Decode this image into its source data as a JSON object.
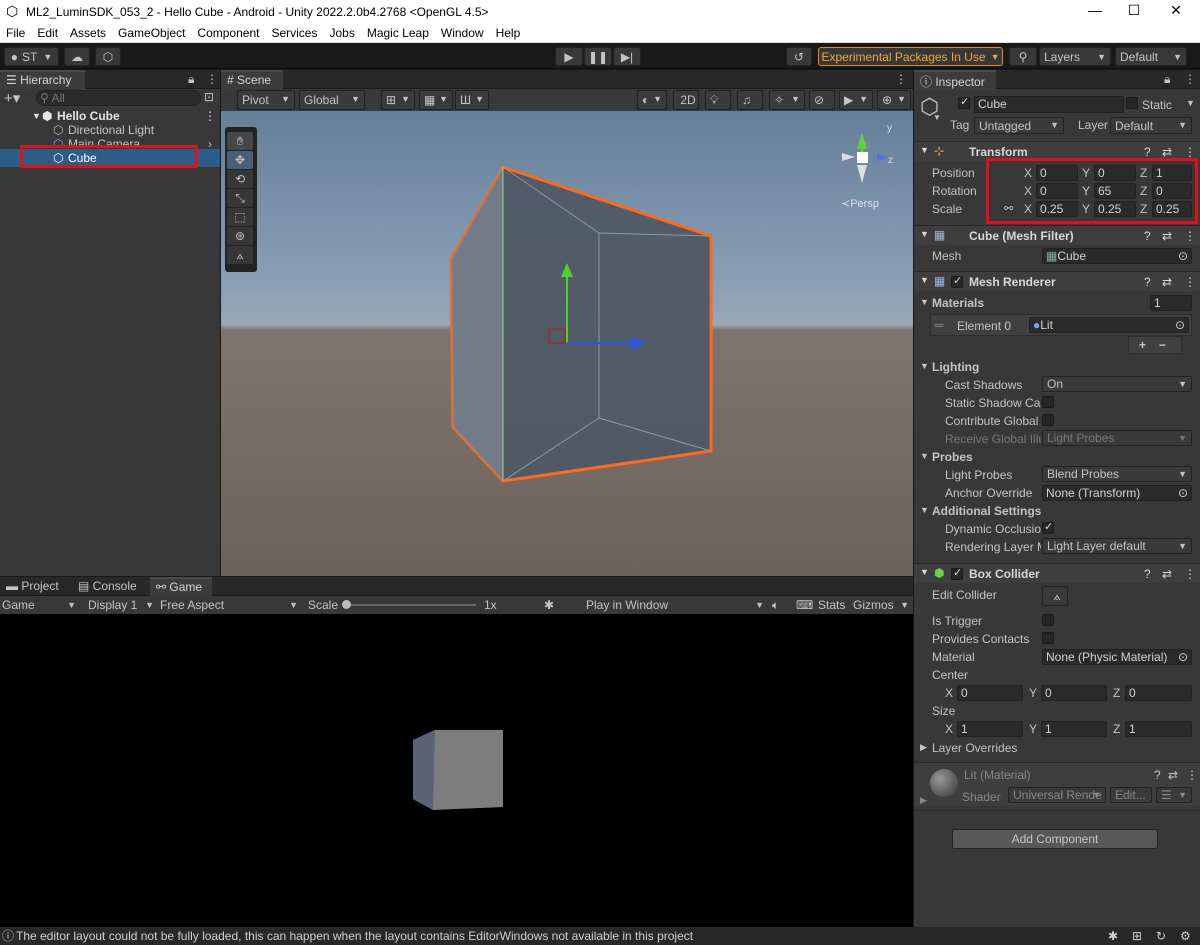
{
  "window": {
    "title": "ML2_LuminSDK_053_2 - Hello Cube - Android - Unity 2022.2.0b4.2768 <OpenGL 4.5>",
    "minimize": "—",
    "maximize": "☐",
    "close": "✕"
  },
  "menu": [
    "File",
    "Edit",
    "Assets",
    "GameObject",
    "Component",
    "Services",
    "Jobs",
    "Magic Leap",
    "Window",
    "Help"
  ],
  "toolbar": {
    "account": "ST",
    "experimental": "Experimental Packages In Use",
    "layers": "Layers",
    "layout": "Default"
  },
  "hierarchy": {
    "tab": "Hierarchy",
    "search_placeholder": "All",
    "scene": "Hello Cube",
    "items": [
      "Directional Light",
      "Main Camera",
      "Cube"
    ]
  },
  "scene_view": {
    "tab": "Scene",
    "pivot": "Pivot",
    "global": "Global",
    "mode2d": "2D",
    "persp": "Persp"
  },
  "bottom": {
    "tabs": [
      "Project",
      "Console",
      "Game"
    ],
    "game": "Game",
    "display": "Display 1",
    "aspect": "Free Aspect",
    "scale_label": "Scale",
    "scale_value": "1x",
    "play_in": "Play in Window",
    "stats": "Stats",
    "gizmos": "Gizmos"
  },
  "inspector": {
    "tab": "Inspector",
    "name": "Cube",
    "static": "Static",
    "tag_label": "Tag",
    "tag": "Untagged",
    "layer_label": "Layer",
    "layer": "Default",
    "transform": {
      "title": "Transform",
      "position_label": "Position",
      "rotation_label": "Rotation",
      "scale_label": "Scale",
      "position": [
        "0",
        "0",
        "1"
      ],
      "rotation": [
        "0",
        "65",
        "0"
      ],
      "scale": [
        "0.25",
        "0.25",
        "0.25"
      ]
    },
    "mesh_filter": {
      "title": "Cube (Mesh Filter)",
      "mesh_label": "Mesh",
      "mesh": "Cube"
    },
    "mesh_renderer": {
      "title": "Mesh Renderer",
      "materials_label": "Materials",
      "materials_count": "1",
      "element0_label": "Element 0",
      "element0": "Lit",
      "lighting_label": "Lighting",
      "cast_shadows_label": "Cast Shadows",
      "cast_shadows": "On",
      "static_shadow_label": "Static Shadow Cas",
      "contribute_gi_label": "Contribute Global I",
      "receive_gi_label": "Receive Global Illu",
      "receive_gi": "Light Probes",
      "probes_label": "Probes",
      "light_probes_label": "Light Probes",
      "light_probes": "Blend Probes",
      "anchor_label": "Anchor Override",
      "anchor": "None (Transform)",
      "additional_label": "Additional Settings",
      "dynamic_occ_label": "Dynamic Occlusio",
      "rendering_layer_label": "Rendering Layer M",
      "rendering_layer": "Light Layer default"
    },
    "box_collider": {
      "title": "Box Collider",
      "edit_label": "Edit Collider",
      "trigger_label": "Is Trigger",
      "contacts_label": "Provides Contacts",
      "material_label": "Material",
      "material": "None (Physic Material)",
      "center_label": "Center",
      "center": [
        "0",
        "0",
        "0"
      ],
      "size_label": "Size",
      "size": [
        "1",
        "1",
        "1"
      ],
      "layer_overrides": "Layer Overrides"
    },
    "material": {
      "name": "Lit (Material)",
      "shader_label": "Shader",
      "shader": "Universal Rende",
      "edit": "Edit..."
    },
    "add_component": "Add Component"
  },
  "status": "The editor layout could not be fully loaded, this can happen when the layout contains EditorWindows not available in this project"
}
